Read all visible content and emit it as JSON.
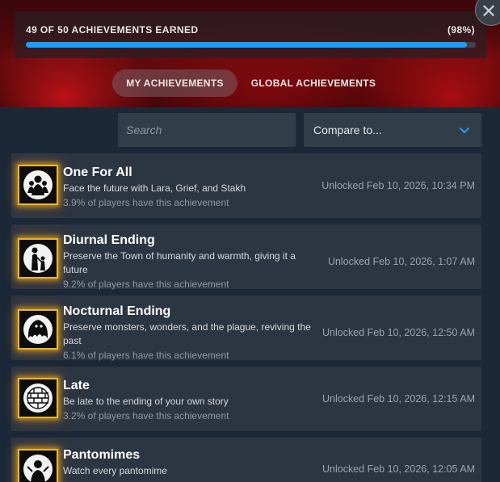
{
  "progress": {
    "label": "49 OF 50 ACHIEVEMENTS EARNED",
    "percent_label": "(98%)",
    "fraction": 0.98
  },
  "tabs": [
    {
      "label": "MY ACHIEVEMENTS",
      "active": true
    },
    {
      "label": "GLOBAL ACHIEVEMENTS",
      "active": false
    }
  ],
  "search": {
    "placeholder": "Search",
    "value": ""
  },
  "compare": {
    "label": "Compare to..."
  },
  "colors": {
    "accent": "#1a9fff",
    "badge_border": "#e9b72c",
    "row_bg": "#2c3542",
    "page_bg": "#1b2838"
  },
  "achievements": [
    {
      "title": "One For All",
      "description": "Face the future with Lara, Grief, and Stakh",
      "percent": "3.9% of players have this achievement",
      "unlocked": "Unlocked Feb 10, 2026, 10:34 PM",
      "icon": "three-figures-icon"
    },
    {
      "title": "Diurnal Ending",
      "description": "Preserve the Town of humanity and warmth, giving it a future",
      "percent": "9.2% of players have this achievement",
      "unlocked": "Unlocked Feb 10, 2026, 1:07 AM",
      "icon": "parent-child-icon"
    },
    {
      "title": "Nocturnal Ending",
      "description": "Preserve monsters, wonders, and the plague, reviving the past",
      "percent": "6.1% of players have this achievement",
      "unlocked": "Unlocked Feb 10, 2026, 12:50 AM",
      "icon": "monster-icon"
    },
    {
      "title": "Late",
      "description": "Be late to the ending of your own story",
      "percent": "3.2% of players have this achievement",
      "unlocked": "Unlocked Feb 10, 2026, 12:15 AM",
      "icon": "brick-wall-icon"
    },
    {
      "title": "Pantomimes",
      "description": "Watch every pantomime",
      "percent": "",
      "unlocked": "Unlocked Feb 10, 2026, 12:05 AM",
      "icon": "mime-icon"
    }
  ]
}
